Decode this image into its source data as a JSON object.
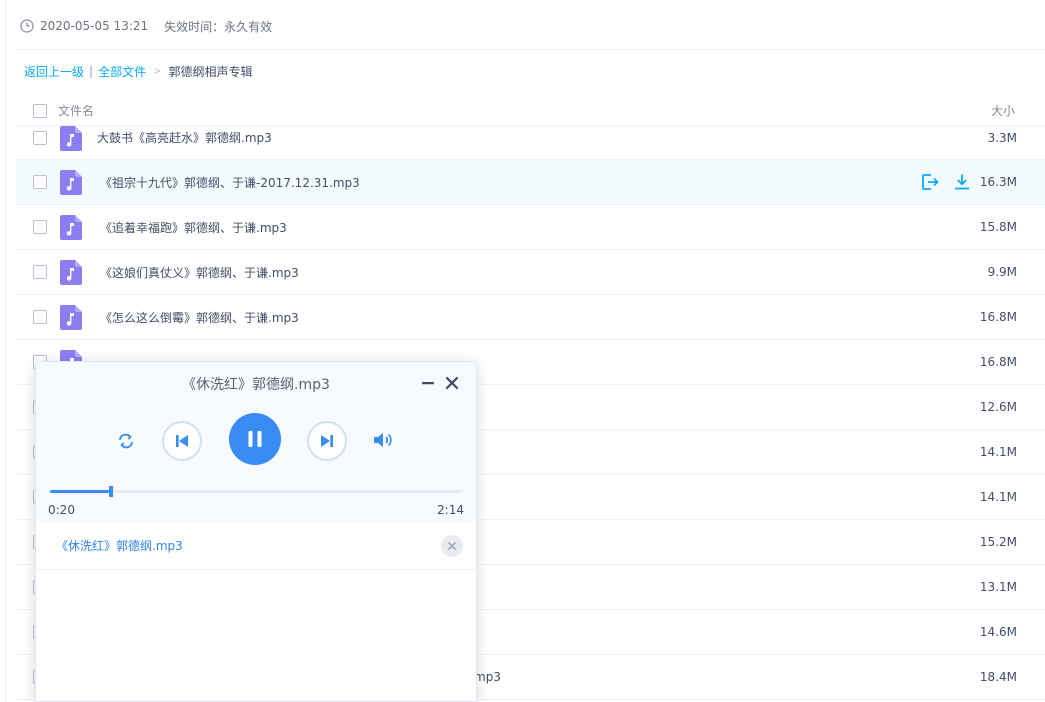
{
  "share_info": {
    "date": "2020-05-05 13:21",
    "expiry": "失效时间：永久有效"
  },
  "breadcrumb": {
    "back": "返回上一级",
    "separator": "|",
    "all_files": "全部文件",
    "arrow": ">",
    "current": "郭德纲相声专辑"
  },
  "list_header": {
    "name": "文件名",
    "size": "大小"
  },
  "files": [
    {
      "name": "大鼓书《高亮赶水》郭德纲.mp3",
      "size": "3.3M"
    },
    {
      "name": "《祖宗十九代》郭德纲、于谦-2017.12.31.mp3",
      "size": "16.3M"
    },
    {
      "name": "《追着幸福跑》郭德纲、于谦.mp3",
      "size": "15.8M"
    },
    {
      "name": "《这娘们真仗义》郭德纲、于谦.mp3",
      "size": "9.9M"
    },
    {
      "name": "《怎么这么倒霉》郭德纲、于谦.mp3",
      "size": "16.8M"
    },
    {
      "name": "",
      "size": "16.8M"
    },
    {
      "name": "",
      "size": "12.6M"
    },
    {
      "name": "",
      "size": "14.1M"
    },
    {
      "name": "",
      "size": "14.1M"
    },
    {
      "name": "",
      "size": "15.2M"
    },
    {
      "name": "",
      "size": "13.1M"
    },
    {
      "name": "",
      "size": "14.6M"
    },
    {
      "name": "mp3",
      "size": "18.4M"
    }
  ],
  "player": {
    "title": "《休洗红》郭德纲.mp3",
    "current_time": "0:20",
    "total_time": "2:14",
    "progress_fraction": 0.149,
    "playlist": [
      {
        "name": "《休洗红》郭德纲.mp3"
      }
    ]
  },
  "colors": {
    "accent": "#3a8bf2",
    "link": "#09aaff",
    "file_icon": "#8d7df2"
  },
  "icons": {
    "clock": "clock-icon",
    "file": "music-file-icon",
    "share": "share-icon",
    "download": "download-icon",
    "minimize": "minimize-icon",
    "close": "close-icon",
    "loop": "loop-icon",
    "prev": "skip-previous-icon",
    "pause": "pause-icon",
    "next": "skip-next-icon",
    "volume": "volume-icon",
    "remove": "remove-icon"
  }
}
